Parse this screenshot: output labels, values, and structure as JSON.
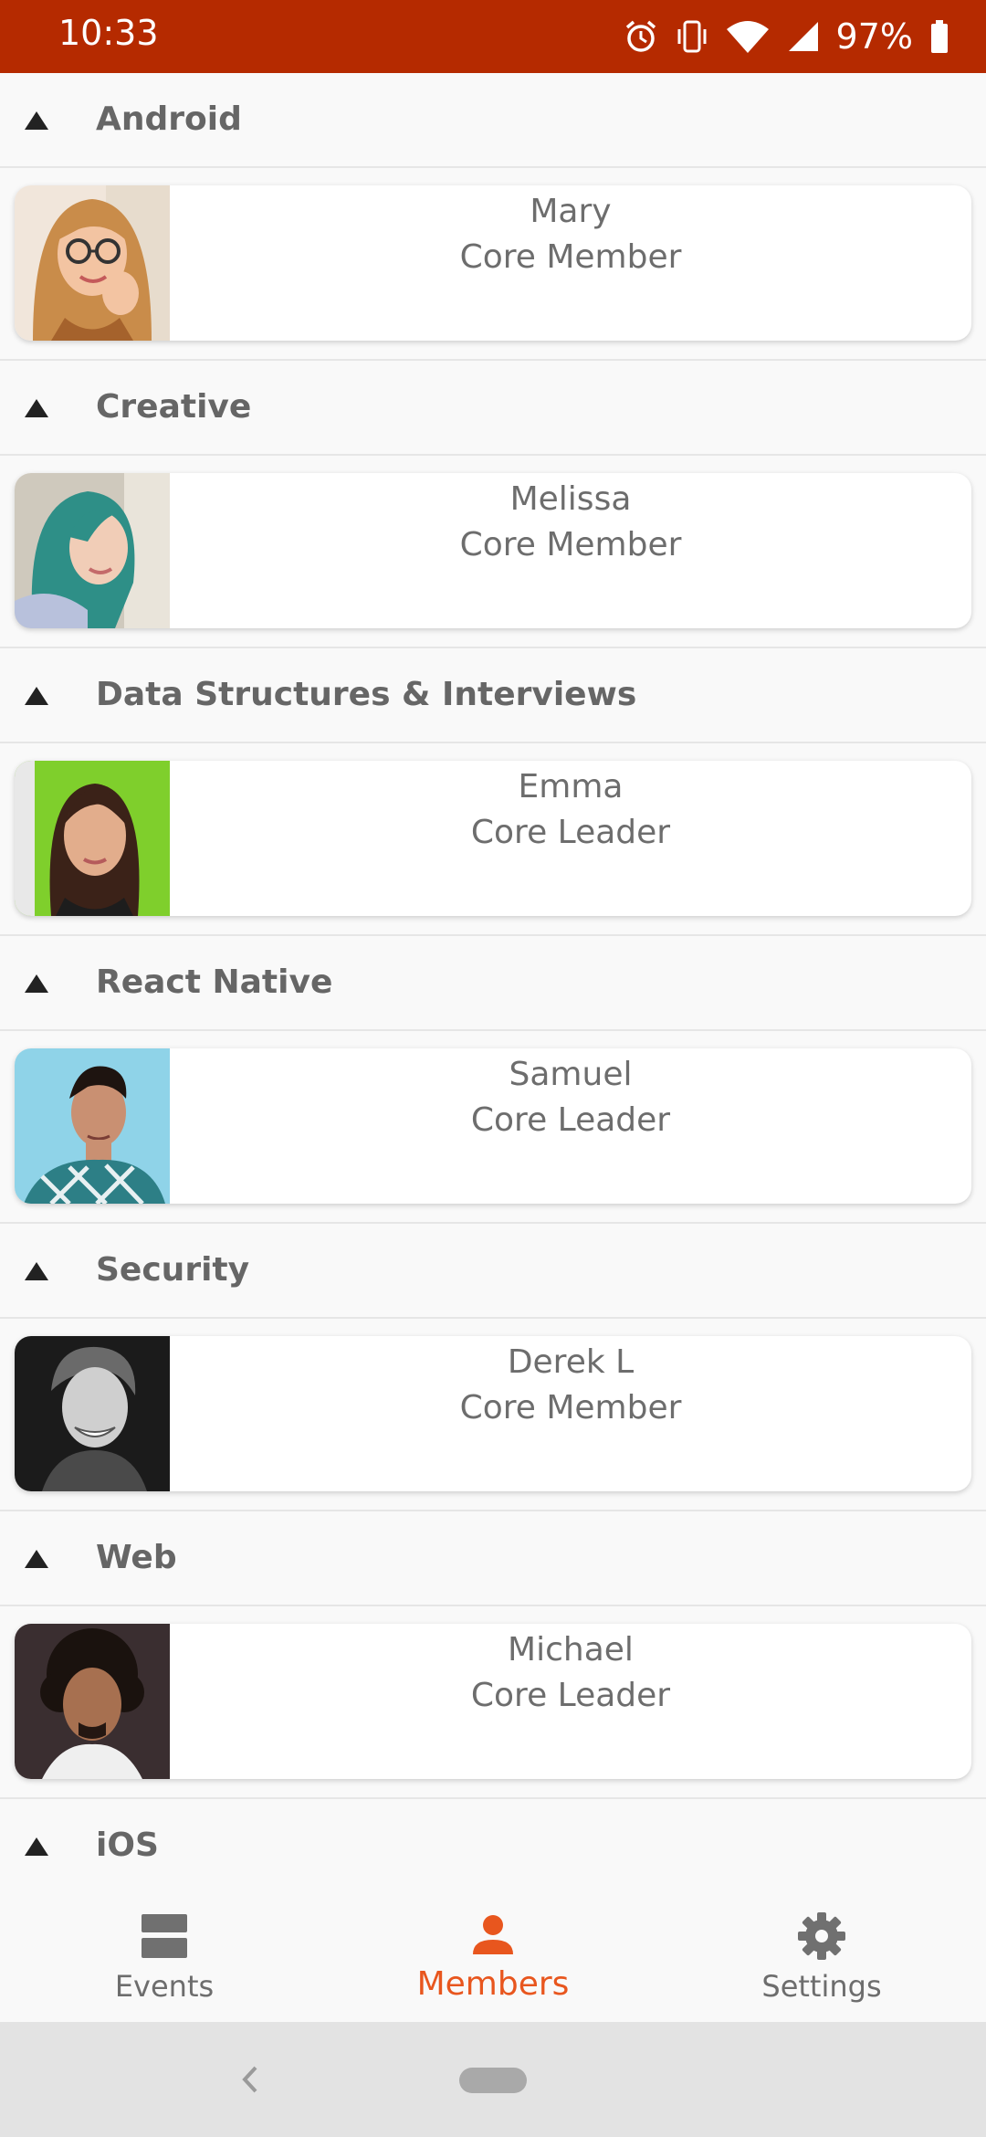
{
  "status_bar": {
    "time": "10:33",
    "battery_percent": "97%",
    "icons": [
      "alarm-icon",
      "vibrate-icon",
      "wifi-icon",
      "signal-icon",
      "battery-icon"
    ],
    "background_color": "#b52a00"
  },
  "sections": [
    {
      "title": "Android",
      "member": {
        "name": "Mary",
        "role": "Core Member"
      }
    },
    {
      "title": "Creative",
      "member": {
        "name": "Melissa",
        "role": "Core Member"
      }
    },
    {
      "title": "Data Structures & Interviews",
      "member": {
        "name": "Emma",
        "role": "Core Leader"
      }
    },
    {
      "title": "React Native",
      "member": {
        "name": "Samuel",
        "role": "Core Leader"
      }
    },
    {
      "title": "Security",
      "member": {
        "name": "Derek L",
        "role": "Core Member"
      }
    },
    {
      "title": "Web",
      "member": {
        "name": "Michael",
        "role": "Core Leader"
      }
    },
    {
      "title": "iOS"
    }
  ],
  "bottom_nav": {
    "items": [
      {
        "label": "Events",
        "icon": "events-icon"
      },
      {
        "label": "Members",
        "icon": "person-icon",
        "active": true
      },
      {
        "label": "Settings",
        "icon": "gear-icon"
      }
    ],
    "active_color": "#e8561e"
  },
  "system_nav": {
    "icons": [
      "back-icon",
      "home-pill"
    ]
  }
}
